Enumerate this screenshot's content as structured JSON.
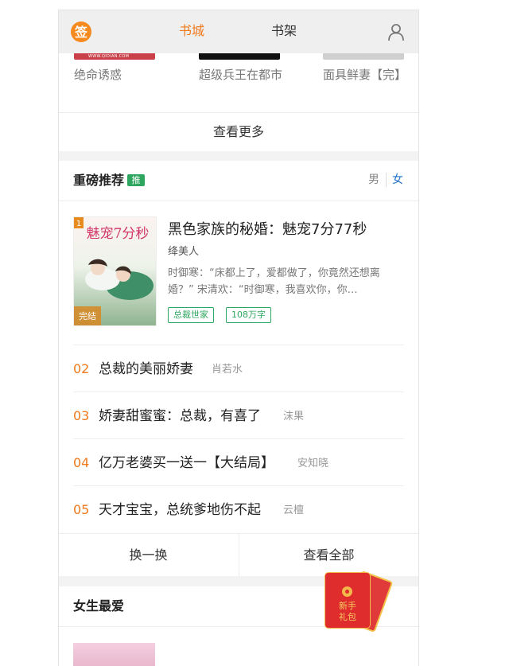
{
  "header": {
    "tabs": [
      {
        "label": "书城",
        "active": true
      },
      {
        "label": "书架",
        "active": false
      }
    ],
    "logo_icon": "qidian-sign-logo-icon",
    "user_icon": "user-icon",
    "accent_color": "#f0791c"
  },
  "top_books": [
    {
      "title": "绝命诱惑",
      "cover_text": "WWW.QIDIAN.COM"
    },
    {
      "title": "超级兵王在都市",
      "cover_text": ""
    },
    {
      "title": "面具鲜妻【完】",
      "cover_text": ""
    }
  ],
  "more_label": "查看更多",
  "recommend": {
    "title": "重磅推荐",
    "badge": "推",
    "gender_male": "男",
    "gender_female": "女",
    "featured": {
      "rank": "1",
      "status": "完结",
      "cover_title": "魅宠7分秒",
      "title": "黑色家族的秘婚：魅宠7分77秒",
      "author": "绛美人",
      "desc": "时御寒：“床都上了，爱都做了，你竟然还想离婚？” 宋清欢：“时御寒，我喜欢你，你…",
      "tags": [
        "总裁世家",
        "108万字"
      ]
    },
    "list": [
      {
        "num": "02",
        "title": "总裁的美丽娇妻",
        "author": "肖若水"
      },
      {
        "num": "03",
        "title": "娇妻甜蜜蜜：总裁，有喜了",
        "author": "沫果"
      },
      {
        "num": "04",
        "title": "亿万老婆买一送一【大结局】",
        "author": "安知晓"
      },
      {
        "num": "05",
        "title": "天才宝宝，总统爹地伤不起",
        "author": "云檀"
      }
    ],
    "refresh_label": "换一换",
    "view_all_label": "查看全部"
  },
  "girls": {
    "title": "女生最爱"
  },
  "envelope": {
    "label_line1": "新手",
    "label_line2": "礼包",
    "icon": "red-envelope-icon"
  }
}
